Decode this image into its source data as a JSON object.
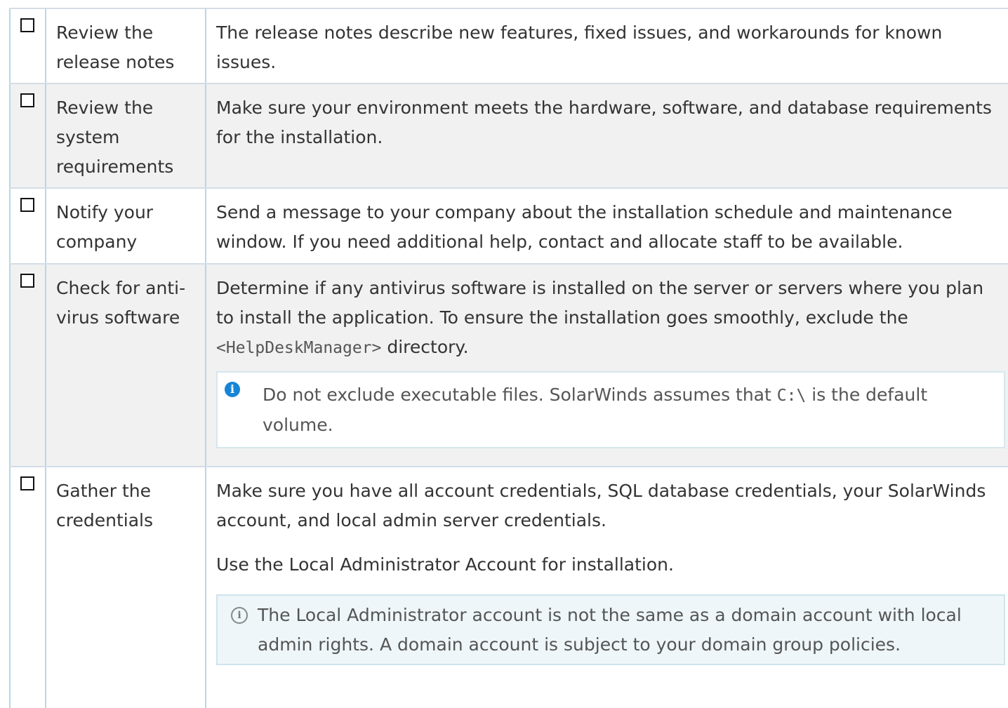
{
  "rows": [
    {
      "task": "Review the release notes",
      "description": "The release notes describe new features, fixed issues, and workarounds for known issues."
    },
    {
      "task": "Review the system requirements",
      "description": "Make sure your environment meets the hardware, software, and database requirements for the installation."
    },
    {
      "task": "Notify your company",
      "description": "Send a message to your company about the installation schedule and maintenance window. If you need additional help, contact and allocate staff to be available."
    },
    {
      "task": "Check for anti-virus software",
      "description_before": "Determine if any antivirus software is installed on the server or servers where you plan to install the application. To ensure the installation goes smoothly, exclude the ",
      "description_code": "<HelpDeskManager>",
      "description_after": " directory.",
      "note_before": "Do not exclude executable files. SolarWinds assumes that ",
      "note_code": "C:\\",
      "note_after": " is the default volume."
    },
    {
      "task": "Gather the credentials",
      "description": "Make sure you have all account credentials, SQL database credentials, your SolarWinds account, and local admin server credentials.",
      "description_2": "Use the Local Administrator Account for installation.",
      "tip": "The Local Administrator account is not the same as a domain account with local admin rights. A domain account is subject to your domain group policies."
    }
  ],
  "icons": {
    "checkbox": "checkbox-unchecked",
    "note": "info-filled-icon",
    "tip": "info-outline-icon"
  },
  "colors": {
    "shaded_row": "#f1f1f1",
    "border": "#b9d6e6",
    "info_blue": "#1685d6",
    "tip_background": "#eef6f9"
  }
}
